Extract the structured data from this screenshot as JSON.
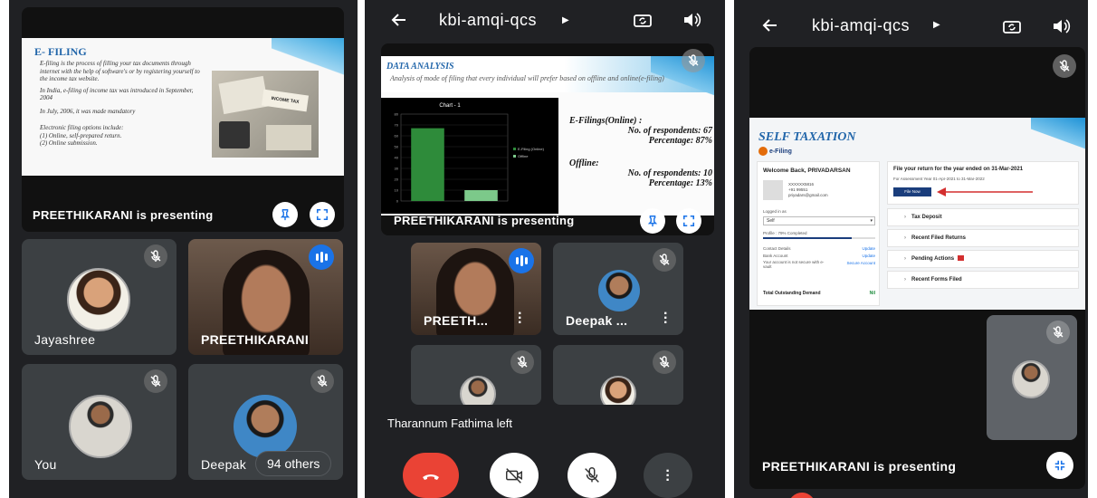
{
  "left": {
    "slide": {
      "title": "E- FILING",
      "bullets": [
        "E-filing is the process of filling your tax documents through internet with the help of software's or by registering yourself to the income tax website.",
        "In India, e-filing of income tax was introduced in September, 2004",
        "In July, 2006, it was made mandatory",
        "Electronic filing options include:"
      ],
      "sub_items": [
        "(1) Online, self-prepared return.",
        "(2) Online submission."
      ],
      "image_text": "INCOME TAX"
    },
    "presenting_label": "PREETHIKARANI is presenting",
    "tiles": [
      {
        "name": "Jayashree"
      },
      {
        "name": "PREETHIKARANI"
      },
      {
        "name": "You"
      },
      {
        "name": "Deepak"
      }
    ],
    "others_badge": "94 others"
  },
  "middle": {
    "title": "kbi-amqi-qcs",
    "slide": {
      "title": "DATA ANALYSIS",
      "subtitle": "Analysis of mode of filing that every individual will prefer based on offline and online(e-filing)",
      "online_heading": "E-Filings(Online) :",
      "online_resp": "No. of respondents: 67",
      "online_pct": "Percentage: 87%",
      "offline_heading": "Offline:",
      "offline_resp": "No. of respondents: 10",
      "offline_pct": "Percentage: 13%"
    },
    "presenting_label": "PREETHIKARANI is presenting",
    "tiles": [
      {
        "name": "PREETH..."
      },
      {
        "name": "Deepak ..."
      }
    ],
    "toast": "Tharannum Fathima left"
  },
  "chart_data": {
    "type": "bar",
    "title": "Chart - 1",
    "categories": [
      "E-Filing (Online)",
      "Offline"
    ],
    "values": [
      67,
      10
    ],
    "ylim": [
      0,
      80
    ],
    "legend": [
      "E-Filing (Online)",
      "Offline"
    ],
    "colors": [
      "#2e8b3a",
      "#7cc98a"
    ]
  },
  "right": {
    "title": "kbi-amqi-qcs",
    "slide": {
      "title": "SELF TAXATION",
      "logo_text": "e-Filing",
      "welcome": "Welcome Back, PRIVADARSAN",
      "pan_label": "XXXXXX5816",
      "phone": "+91 99551",
      "email": "priyadars@gmail.com",
      "logged_as_label": "Logged in as",
      "logged_as_value": "Self",
      "profile_label": "Profile : 79% Completed",
      "links": [
        {
          "label": "Contact Details",
          "action": "Update"
        },
        {
          "label": "Bank Account",
          "action": "Update"
        },
        {
          "label": "Your account is not secure with e-vault",
          "action": "Secure Account"
        }
      ],
      "outstanding_label": "Total Outstanding Demand",
      "outstanding_value": "Nil",
      "file_heading": "File your return for the year ended on 31-Mar-2021",
      "assessment_year": "For Assessment Year 01-Apr-2021 to 31-Mar-2022",
      "file_now": "File Now",
      "sections": [
        "Tax Deposit",
        "Recent Filed Returns",
        "Pending Actions",
        "Recent Forms Filed"
      ]
    },
    "presenting_label": "PREETHIKARANI is presenting"
  }
}
